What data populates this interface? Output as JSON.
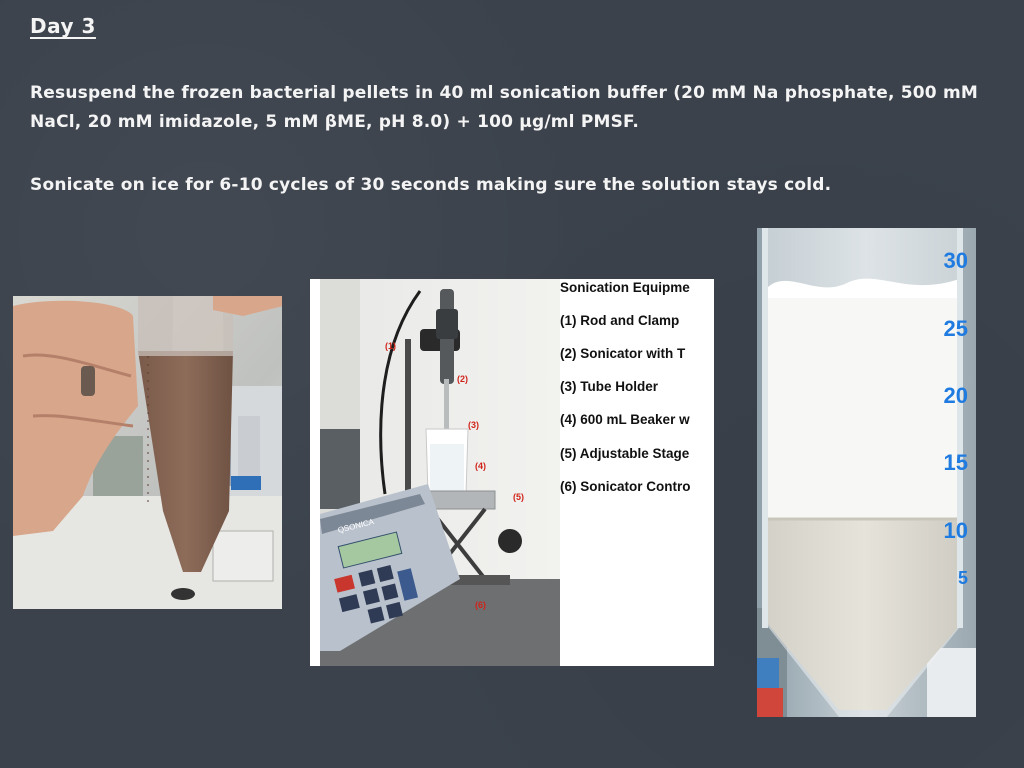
{
  "slide": {
    "title": "Day 3",
    "paragraphs": [
      "Resuspend the frozen bacterial pellets in 40 ml sonication buffer (20 mM Na phosphate, 500 mM NaCl, 20 mM imidazole, 5 mM βME, pH 8.0) + 100 μg/ml PMSF.",
      "Sonicate on ice for 6-10 cycles of 30 seconds making sure the solution stays cold."
    ]
  },
  "equipment_figure": {
    "legend_title": "Sonication Equipme",
    "items": [
      "(1) Rod and Clamp",
      "(2) Sonicator with T",
      "(3) Tube Holder",
      "(4) 600 mL Beaker w",
      "(5) Adjustable Stage",
      "(6) Sonicator Contro"
    ],
    "callouts": [
      "(1)",
      "(2)",
      "(3)",
      "(4)",
      "(5)",
      "(6)"
    ],
    "device_brand": "QSONICA"
  },
  "tube_photo": {
    "scale_marks": [
      "30",
      "25",
      "20",
      "15",
      "10",
      "5"
    ]
  }
}
